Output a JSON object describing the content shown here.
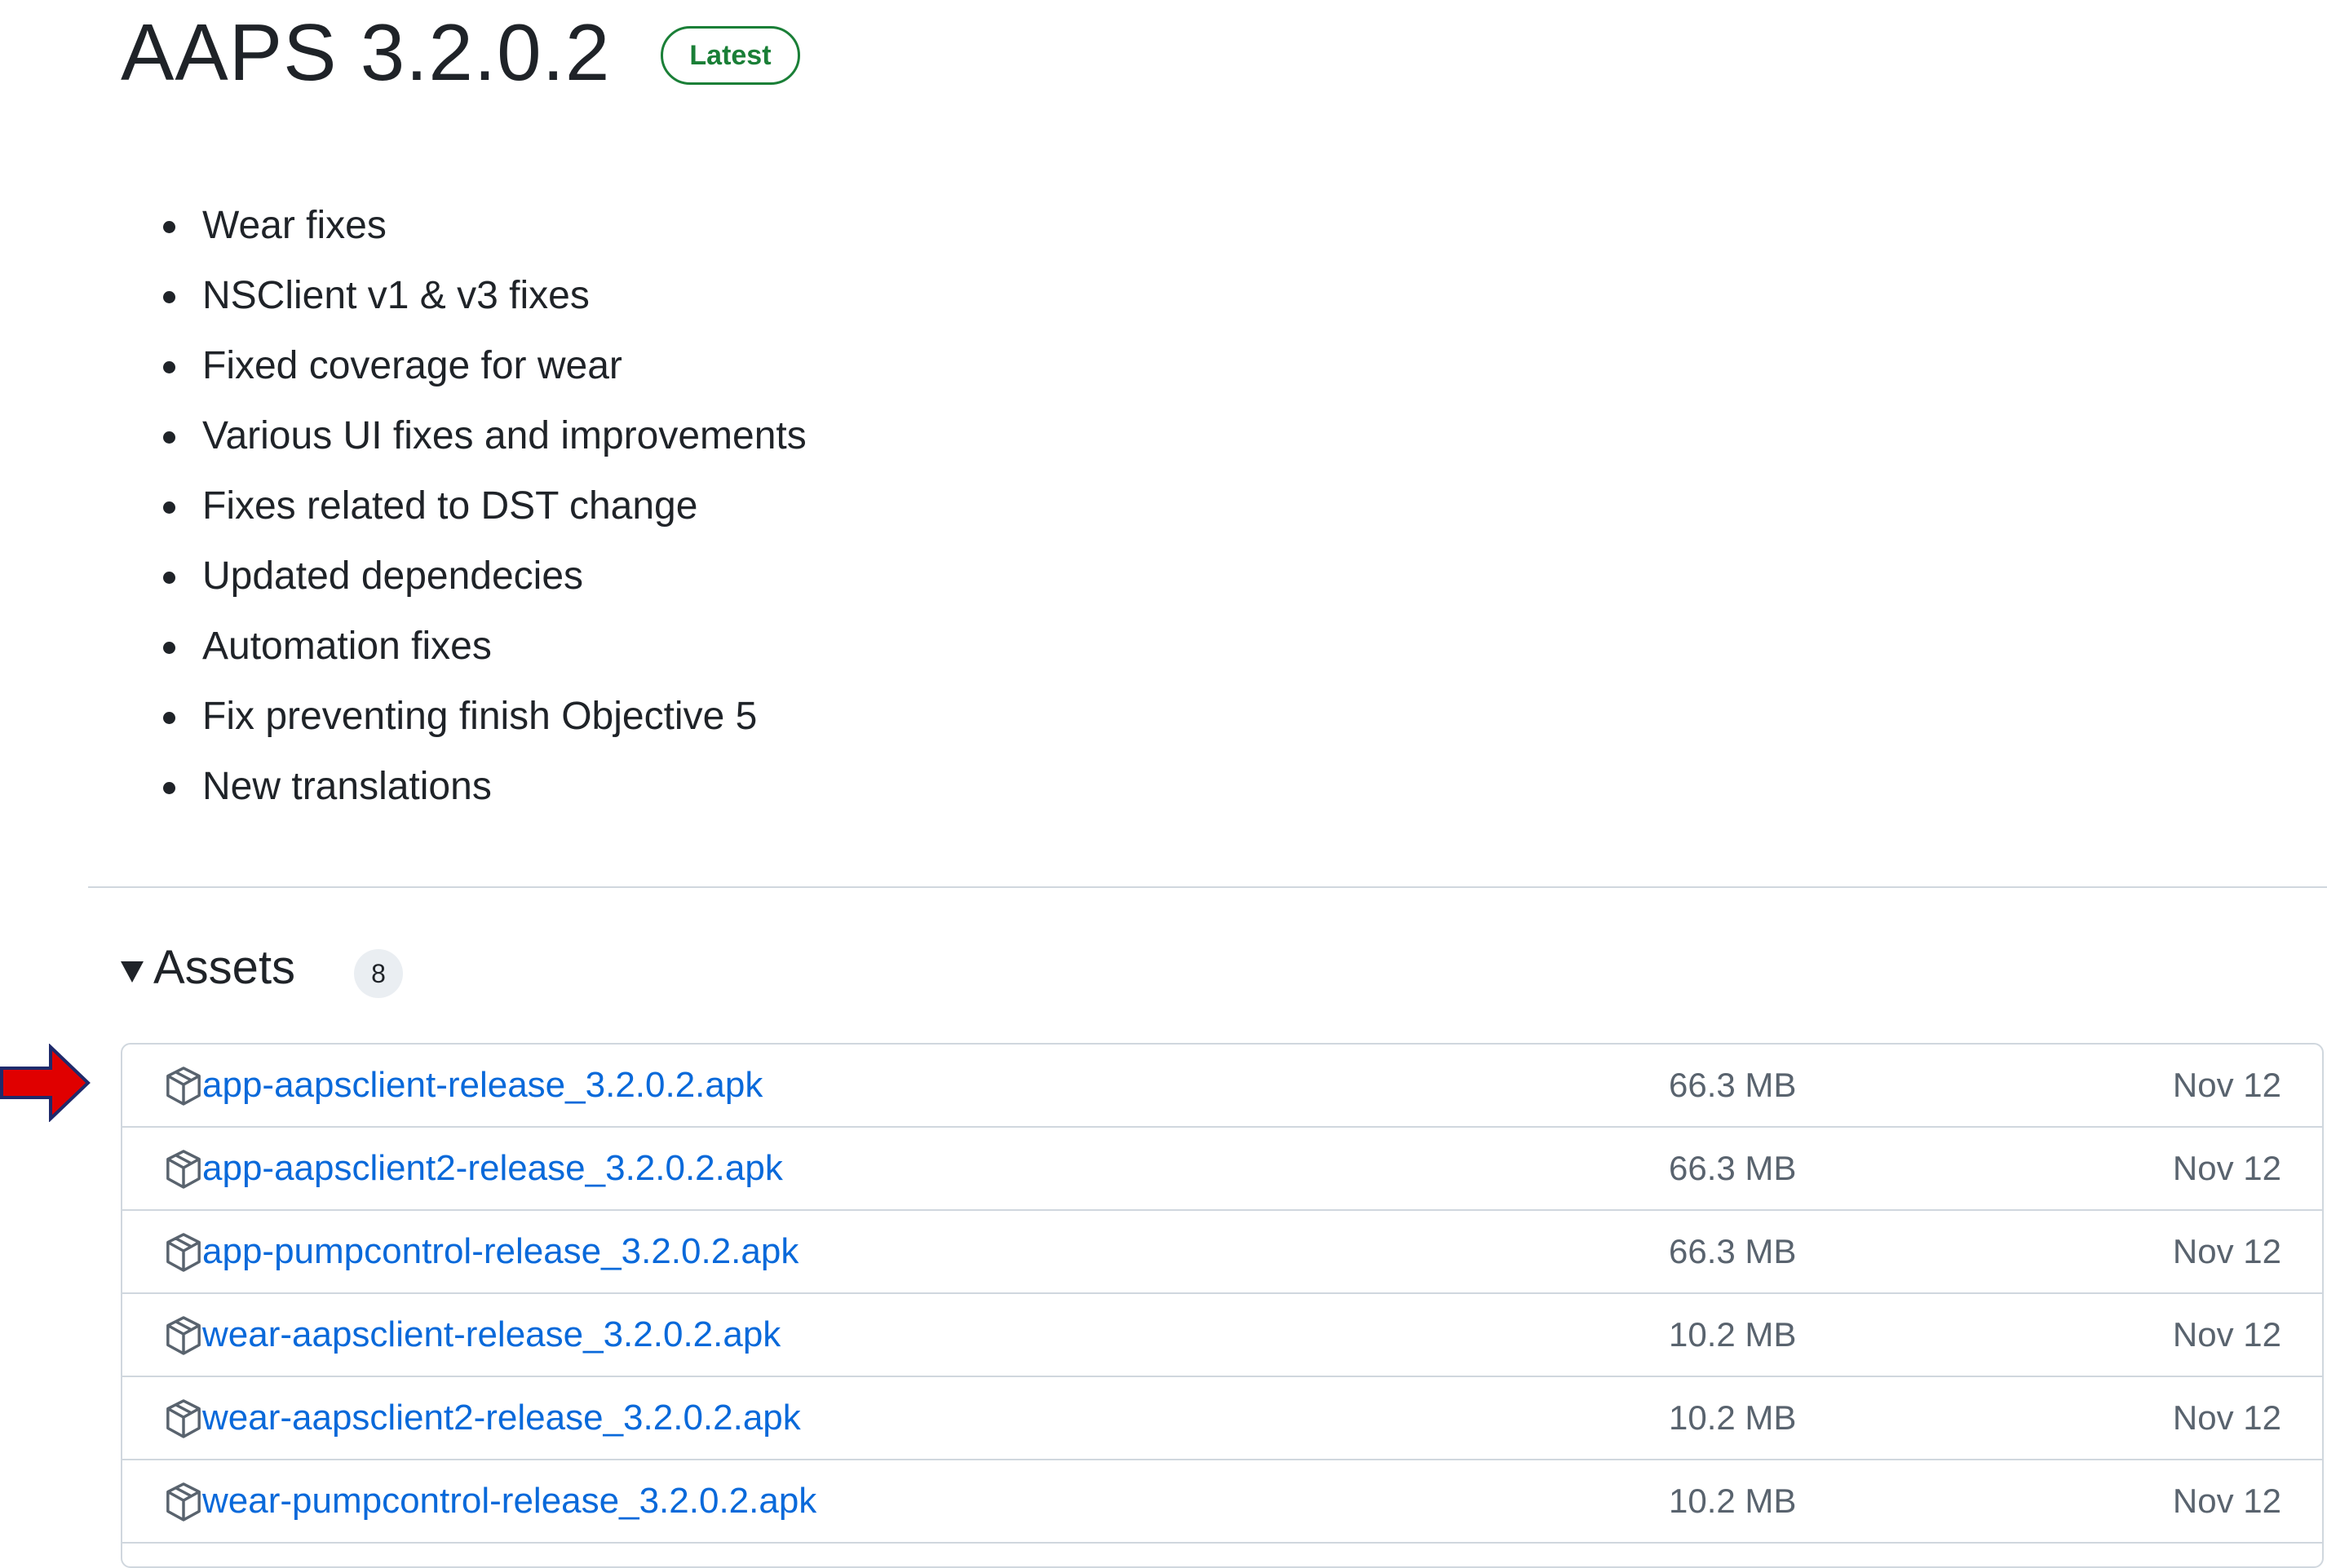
{
  "release": {
    "title": "AAPS 3.2.0.2",
    "badge": "Latest"
  },
  "notes": [
    "Wear fixes",
    "NSClient v1 & v3 fixes",
    "Fixed coverage for wear",
    "Various UI fixes and improvements",
    "Fixes related to DST change",
    "Updated dependecies",
    "Automation fixes",
    "Fix preventing finish Objective 5",
    "New translations"
  ],
  "assets": {
    "title": "Assets",
    "count": "8",
    "rows": [
      {
        "name": "app-aapsclient-release_3.2.0.2.apk",
        "size": "66.3 MB",
        "date": "Nov 12"
      },
      {
        "name": "app-aapsclient2-release_3.2.0.2.apk",
        "size": "66.3 MB",
        "date": "Nov 12"
      },
      {
        "name": "app-pumpcontrol-release_3.2.0.2.apk",
        "size": "66.3 MB",
        "date": "Nov 12"
      },
      {
        "name": "wear-aapsclient-release_3.2.0.2.apk",
        "size": "10.2 MB",
        "date": "Nov 12"
      },
      {
        "name": "wear-aapsclient2-release_3.2.0.2.apk",
        "size": "10.2 MB",
        "date": "Nov 12"
      },
      {
        "name": "wear-pumpcontrol-release_3.2.0.2.apk",
        "size": "10.2 MB",
        "date": "Nov 12"
      }
    ]
  },
  "icons": {
    "asset": "package-icon",
    "pointer": "red-arrow-icon",
    "toggle": "caret-down-icon"
  },
  "colors": {
    "link": "#0969da",
    "badge": "#1a7f37",
    "arrow": "#e00000"
  }
}
